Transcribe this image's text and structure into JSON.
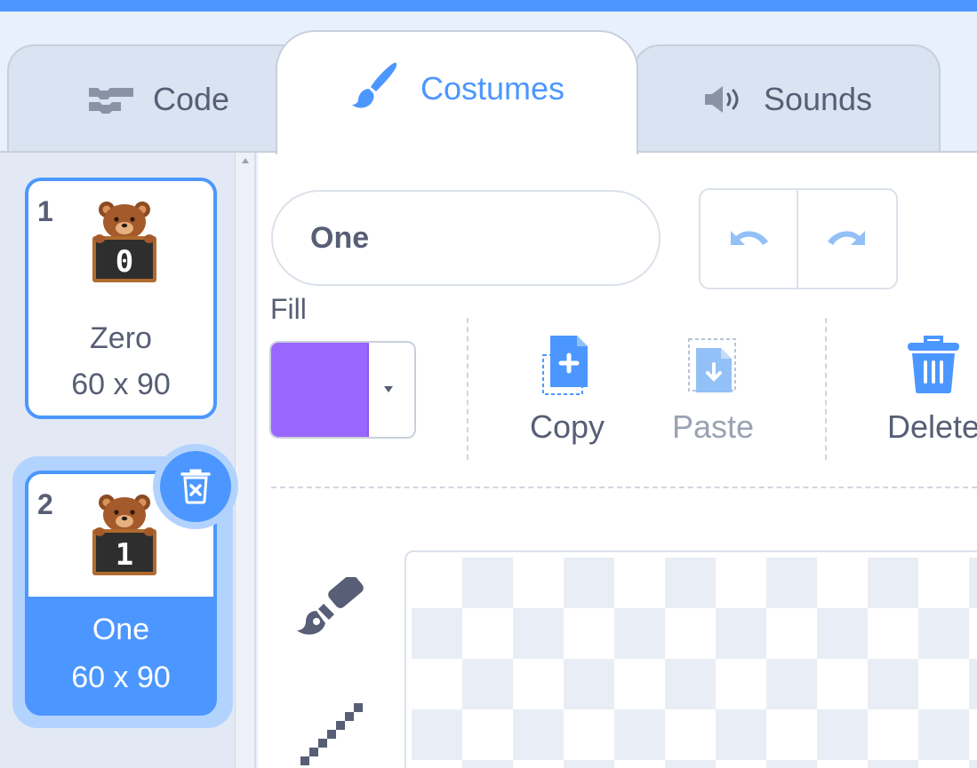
{
  "tabs": {
    "code": {
      "label": "Code",
      "icon": "code-blocks-icon"
    },
    "costumes": {
      "label": "Costumes",
      "icon": "paintbrush-icon",
      "active": true
    },
    "sounds": {
      "label": "Sounds",
      "icon": "speaker-icon"
    }
  },
  "costumes": [
    {
      "number": "1",
      "name": "Zero",
      "size": "60 x 90",
      "thumbnail_digit": "0",
      "selected": false
    },
    {
      "number": "2",
      "name": "One",
      "size": "60 x 90",
      "thumbnail_digit": "1",
      "selected": true
    }
  ],
  "editor": {
    "costume_name": "One",
    "fill_label": "Fill",
    "fill_color": "#9966ff",
    "actions": {
      "copy": "Copy",
      "paste": "Paste",
      "delete": "Delete"
    }
  },
  "colors": {
    "accent": "#4c97ff",
    "text": "#575e75",
    "disabled_text": "#9aa3b2",
    "fill_swatch": "#9966ff"
  }
}
